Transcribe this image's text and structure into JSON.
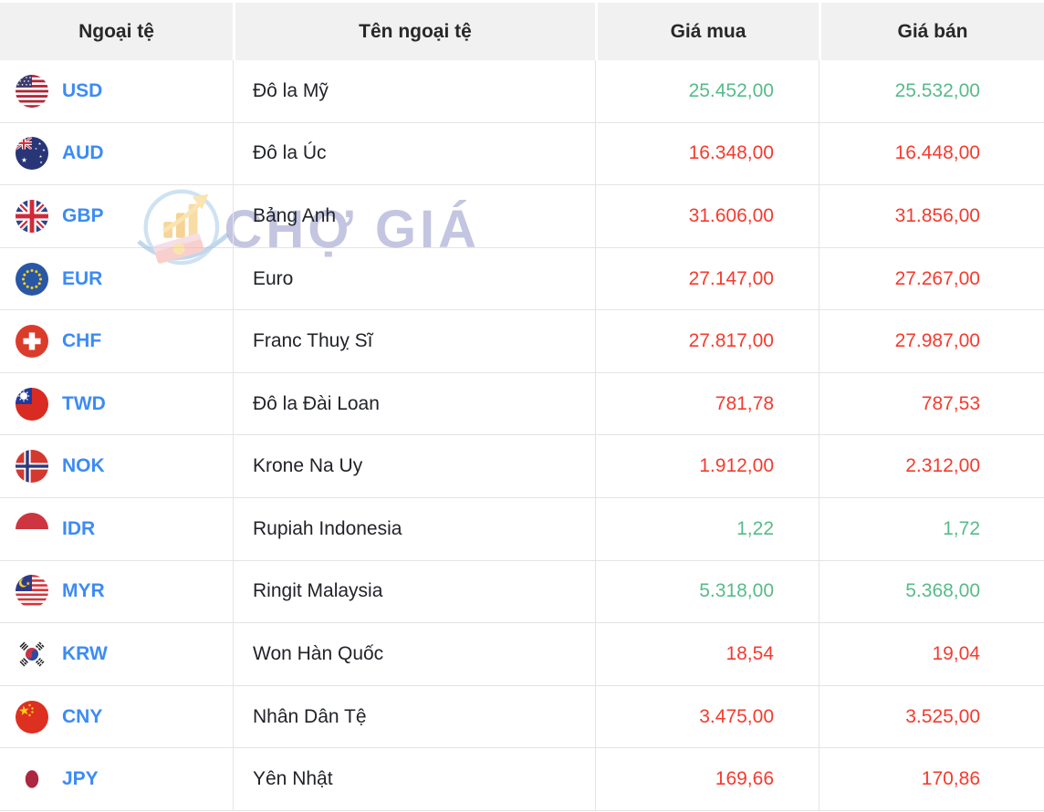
{
  "table": {
    "headers": {
      "currency": "Ngoại tệ",
      "name": "Tên ngoại tệ",
      "buy": "Giá mua",
      "sell": "Giá bán"
    },
    "rows": [
      {
        "code": "USD",
        "name": "Đô la Mỹ",
        "buy": "25.452,00",
        "sell": "25.532,00",
        "trend": "up",
        "flag": "usd-flag-icon"
      },
      {
        "code": "AUD",
        "name": "Đô la Úc",
        "buy": "16.348,00",
        "sell": "16.448,00",
        "trend": "down",
        "flag": "aud-flag-icon"
      },
      {
        "code": "GBP",
        "name": "Bảng Anh",
        "buy": "31.606,00",
        "sell": "31.856,00",
        "trend": "down",
        "flag": "gbp-flag-icon"
      },
      {
        "code": "EUR",
        "name": "Euro",
        "buy": "27.147,00",
        "sell": "27.267,00",
        "trend": "down",
        "flag": "eur-flag-icon"
      },
      {
        "code": "CHF",
        "name": "Franc Thuỵ Sĩ",
        "buy": "27.817,00",
        "sell": "27.987,00",
        "trend": "down",
        "flag": "chf-flag-icon"
      },
      {
        "code": "TWD",
        "name": "Đô la Đài Loan",
        "buy": "781,78",
        "sell": "787,53",
        "trend": "down",
        "flag": "twd-flag-icon"
      },
      {
        "code": "NOK",
        "name": "Krone Na Uy",
        "buy": "1.912,00",
        "sell": "2.312,00",
        "trend": "down",
        "flag": "nok-flag-icon"
      },
      {
        "code": "IDR",
        "name": "Rupiah Indonesia",
        "buy": "1,22",
        "sell": "1,72",
        "trend": "up",
        "flag": "idr-flag-icon"
      },
      {
        "code": "MYR",
        "name": "Ringit Malaysia",
        "buy": "5.318,00",
        "sell": "5.368,00",
        "trend": "up",
        "flag": "myr-flag-icon"
      },
      {
        "code": "KRW",
        "name": "Won Hàn Quốc",
        "buy": "18,54",
        "sell": "19,04",
        "trend": "down",
        "flag": "krw-flag-icon"
      },
      {
        "code": "CNY",
        "name": "Nhân Dân Tệ",
        "buy": "3.475,00",
        "sell": "3.525,00",
        "trend": "down",
        "flag": "cny-flag-icon"
      },
      {
        "code": "JPY",
        "name": "Yên Nhật",
        "buy": "169,66",
        "sell": "170,86",
        "trend": "down",
        "flag": "jpy-flag-icon"
      }
    ]
  },
  "watermark": {
    "text": "CHỢ GIÁ",
    "logo": "cho-gia-logo-icon"
  },
  "colors": {
    "price_up_green": "#57bb8a",
    "price_down_red": "#f43b2e",
    "currency_code_blue": "#3c8bf5",
    "header_bg": "#f1f1f2",
    "grid_border": "#e4e4e4",
    "watermark_lavender": "#9396c9"
  }
}
